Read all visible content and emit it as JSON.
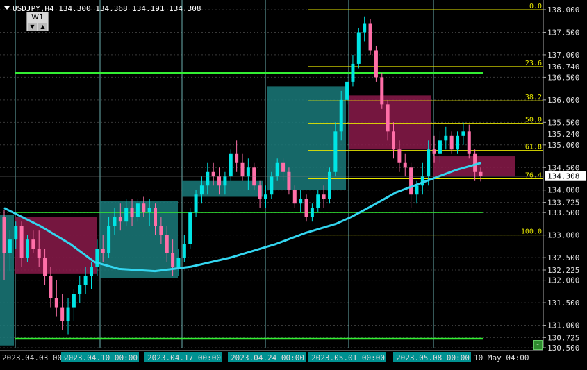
{
  "header": {
    "symbol_line": "USDJPY,H4  134.300 134.368 134.191 134.308",
    "timeframe_button": "W1",
    "arrow_down": "▼",
    "arrow_up": "▲"
  },
  "corner_button": "-",
  "colors": {
    "background": "#000000",
    "grid": "#3a3a3a",
    "bull": "#00e5e5",
    "bear": "#ff6fa8",
    "ma": "#33d6f0",
    "fib": "#e6e600",
    "support": "#33ee33",
    "zone_teal": "#1a7a7a",
    "zone_magenta": "#8a1a4a",
    "vline": "#88dddd"
  },
  "chart_data": {
    "type": "candlestick",
    "ylim": [
      130.5,
      138.0
    ],
    "y_ticks": [
      "138.000",
      "137.500",
      "137.000",
      "136.500",
      "136.000",
      "135.500",
      "135.000",
      "134.500",
      "134.000",
      "133.725",
      "133.500",
      "133.000",
      "132.500",
      "132.225",
      "132.000",
      "131.500",
      "131.000",
      "130.725",
      "130.500"
    ],
    "price_labels": [
      {
        "text": "136.740",
        "value": 136.74,
        "highlight": false
      },
      {
        "text": "135.240",
        "value": 135.24,
        "highlight": false
      },
      {
        "text": "134.308",
        "value": 134.308,
        "highlight": true
      }
    ],
    "x_labels": [
      {
        "text": "2023.04.03 00:00",
        "highlight": false
      },
      {
        "text": "2023.04.10 00:00",
        "highlight": true
      },
      {
        "text": "2023.04.17 00:00",
        "highlight": true
      },
      {
        "text": "2023.04.24 00:00",
        "highlight": true
      },
      {
        "text": "2023.05.01 00:00",
        "highlight": true
      },
      {
        "text": "2023.05.08 00:00",
        "highlight": true
      },
      {
        "text": "10 May 04:00",
        "highlight": false
      }
    ],
    "fibonacci": [
      {
        "level": "0.0",
        "price": 138.0
      },
      {
        "level": "23.6",
        "price": 136.74
      },
      {
        "level": "38.2",
        "price": 135.98
      },
      {
        "level": "50.0",
        "price": 135.48
      },
      {
        "level": "61.8",
        "price": 134.88
      },
      {
        "level": "76.4",
        "price": 134.25
      },
      {
        "level": "100.0",
        "price": 133.0
      }
    ],
    "support_lines": [
      136.6,
      133.5,
      130.7
    ],
    "ma_series": [
      [
        0,
        133.6
      ],
      [
        12,
        133.2
      ],
      [
        22,
        132.8
      ],
      [
        30,
        132.4
      ],
      [
        38,
        132.25
      ],
      [
        50,
        132.2
      ],
      [
        62,
        132.3
      ],
      [
        75,
        132.5
      ],
      [
        90,
        132.8
      ],
      [
        100,
        133.05
      ],
      [
        110,
        133.25
      ],
      [
        115,
        133.4
      ],
      [
        122,
        133.65
      ],
      [
        130,
        133.95
      ],
      [
        140,
        134.2
      ],
      [
        150,
        134.45
      ],
      [
        158,
        134.6
      ]
    ],
    "candles": [
      [
        133.4,
        133.55,
        132.0,
        132.6
      ],
      [
        132.6,
        133.1,
        132.2,
        132.9
      ],
      [
        132.9,
        133.3,
        132.7,
        133.2
      ],
      [
        133.2,
        133.3,
        132.3,
        132.5
      ],
      [
        132.5,
        133.0,
        132.4,
        132.9
      ],
      [
        132.9,
        133.1,
        132.6,
        132.7
      ],
      [
        132.7,
        133.1,
        132.3,
        132.5
      ],
      [
        132.5,
        132.7,
        131.9,
        132.1
      ],
      [
        132.1,
        132.3,
        131.4,
        131.6
      ],
      [
        131.6,
        132.0,
        131.2,
        131.4
      ],
      [
        131.4,
        131.7,
        130.9,
        131.1
      ],
      [
        131.1,
        131.6,
        130.8,
        131.4
      ],
      [
        131.4,
        131.8,
        131.1,
        131.7
      ],
      [
        131.7,
        132.1,
        131.5,
        131.9
      ],
      [
        131.9,
        132.3,
        131.7,
        132.1
      ],
      [
        132.1,
        132.4,
        131.8,
        132.3
      ],
      [
        132.3,
        132.9,
        132.1,
        132.7
      ],
      [
        132.7,
        133.0,
        132.4,
        132.6
      ],
      [
        132.6,
        133.4,
        132.5,
        133.2
      ],
      [
        133.2,
        133.6,
        133.0,
        133.4
      ],
      [
        133.4,
        133.7,
        133.1,
        133.3
      ],
      [
        133.3,
        133.8,
        133.2,
        133.6
      ],
      [
        133.6,
        133.8,
        133.2,
        133.4
      ],
      [
        133.4,
        133.8,
        133.3,
        133.7
      ],
      [
        133.7,
        133.85,
        133.4,
        133.5
      ],
      [
        133.5,
        133.8,
        133.2,
        133.6
      ],
      [
        133.6,
        133.7,
        133.0,
        133.2
      ],
      [
        133.2,
        133.4,
        132.8,
        133.0
      ],
      [
        133.0,
        133.2,
        132.4,
        132.6
      ],
      [
        132.6,
        132.9,
        132.1,
        132.3
      ],
      [
        132.3,
        132.7,
        132.1,
        132.5
      ],
      [
        132.5,
        133.0,
        132.4,
        132.8
      ],
      [
        132.8,
        133.6,
        132.7,
        133.5
      ],
      [
        133.5,
        134.0,
        133.4,
        133.9
      ],
      [
        133.9,
        134.3,
        133.7,
        134.1
      ],
      [
        134.1,
        134.6,
        133.9,
        134.4
      ],
      [
        134.4,
        134.6,
        134.1,
        134.3
      ],
      [
        134.3,
        134.5,
        133.9,
        134.1
      ],
      [
        134.1,
        134.4,
        133.9,
        134.3
      ],
      [
        134.3,
        134.9,
        134.2,
        134.8
      ],
      [
        134.8,
        135.1,
        134.4,
        134.6
      ],
      [
        134.6,
        134.8,
        134.2,
        134.3
      ],
      [
        134.3,
        134.7,
        134.0,
        134.5
      ],
      [
        134.5,
        134.6,
        134.0,
        134.1
      ],
      [
        134.1,
        134.2,
        133.6,
        133.8
      ],
      [
        133.8,
        134.1,
        133.6,
        133.9
      ],
      [
        133.9,
        134.4,
        133.8,
        134.3
      ],
      [
        134.3,
        134.7,
        134.2,
        134.6
      ],
      [
        134.6,
        134.7,
        134.2,
        134.4
      ],
      [
        134.4,
        134.5,
        133.9,
        134.0
      ],
      [
        134.0,
        134.1,
        133.6,
        133.7
      ],
      [
        133.7,
        134.0,
        133.5,
        133.8
      ],
      [
        133.8,
        133.9,
        133.3,
        133.4
      ],
      [
        133.4,
        133.7,
        133.3,
        133.6
      ],
      [
        133.6,
        134.0,
        133.5,
        133.9
      ],
      [
        133.9,
        134.1,
        133.6,
        133.8
      ],
      [
        133.8,
        134.5,
        133.7,
        134.4
      ],
      [
        134.4,
        135.5,
        134.3,
        135.3
      ],
      [
        135.3,
        136.2,
        135.1,
        136.0
      ],
      [
        136.0,
        136.6,
        135.9,
        136.4
      ],
      [
        136.4,
        137.0,
        136.3,
        136.8
      ],
      [
        136.8,
        137.6,
        136.7,
        137.5
      ],
      [
        137.5,
        137.85,
        137.3,
        137.7
      ],
      [
        137.7,
        137.8,
        137.0,
        137.1
      ],
      [
        137.1,
        137.2,
        136.4,
        136.5
      ],
      [
        136.5,
        136.6,
        135.8,
        135.9
      ],
      [
        135.9,
        136.0,
        135.1,
        135.3
      ],
      [
        135.3,
        135.5,
        134.7,
        134.9
      ],
      [
        134.9,
        135.1,
        134.4,
        134.6
      ],
      [
        134.6,
        134.8,
        134.3,
        134.5
      ],
      [
        134.5,
        134.6,
        133.6,
        133.9
      ],
      [
        133.9,
        134.2,
        133.7,
        134.1
      ],
      [
        134.1,
        134.6,
        133.9,
        134.3
      ],
      [
        134.3,
        135.1,
        134.1,
        134.9
      ],
      [
        134.9,
        135.2,
        134.6,
        134.8
      ],
      [
        134.8,
        135.3,
        134.6,
        135.1
      ],
      [
        135.1,
        135.4,
        134.9,
        135.2
      ],
      [
        135.2,
        135.3,
        134.8,
        134.9
      ],
      [
        134.9,
        135.3,
        134.8,
        135.2
      ],
      [
        135.2,
        135.5,
        135.0,
        135.3
      ],
      [
        135.3,
        135.45,
        134.7,
        134.8
      ],
      [
        134.8,
        134.9,
        134.2,
        134.4
      ],
      [
        134.4,
        134.5,
        134.19,
        134.308
      ]
    ]
  }
}
